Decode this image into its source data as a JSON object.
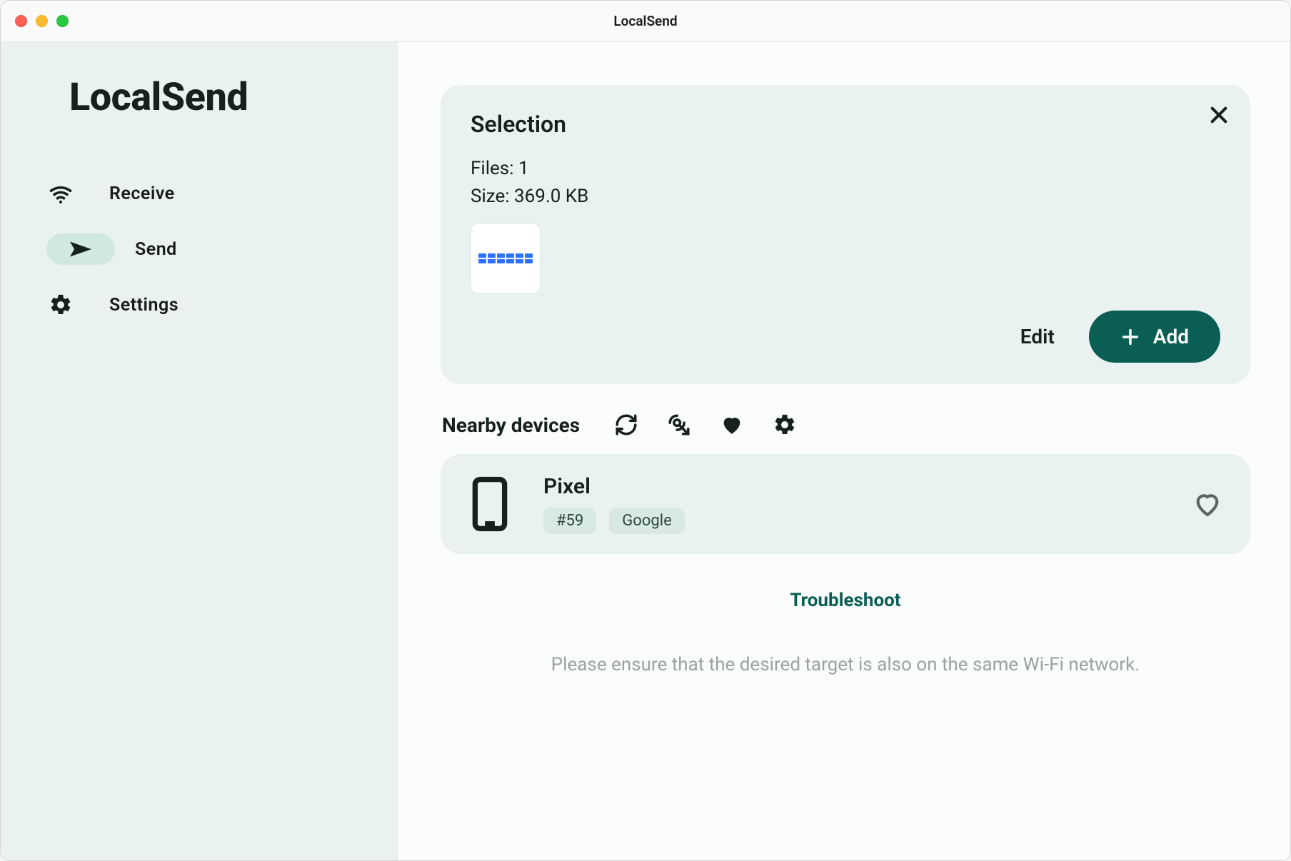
{
  "window": {
    "title": "LocalSend"
  },
  "sidebar": {
    "app_name": "LocalSend",
    "items": [
      {
        "icon": "wifi",
        "label": "Receive",
        "active": false
      },
      {
        "icon": "send",
        "label": "Send",
        "active": true
      },
      {
        "icon": "gear",
        "label": "Settings",
        "active": false
      }
    ]
  },
  "selection": {
    "title": "Selection",
    "files_label": "Files:",
    "files_count": "1",
    "size_label": "Size:",
    "size_value": "369.0 KB",
    "edit_label": "Edit",
    "add_label": "Add"
  },
  "nearby": {
    "label": "Nearby devices",
    "devices": [
      {
        "name": "Pixel",
        "tags": [
          "#59",
          "Google"
        ]
      }
    ]
  },
  "troubleshoot_label": "Troubleshoot",
  "hint": "Please ensure that the desired target is also on the same Wi-Fi network.",
  "colors": {
    "accent": "#0a5e54",
    "sidebar_bg": "#e9f2f0",
    "tag_bg": "#d8e8e3"
  }
}
